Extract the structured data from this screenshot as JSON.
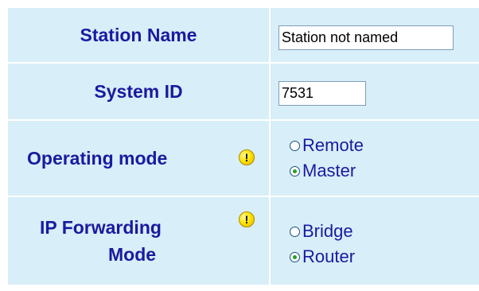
{
  "station_name": {
    "label": "Station Name",
    "value": "Station not named"
  },
  "system_id": {
    "label": "System ID",
    "value": "7531"
  },
  "operating_mode": {
    "label": "Operating mode",
    "warning_icon": "exclamation-warning-icon",
    "options": [
      {
        "label": "Remote",
        "checked": false
      },
      {
        "label": "Master",
        "checked": true
      }
    ]
  },
  "ip_forwarding": {
    "label_line1": "IP Forwarding",
    "label_line2": "Mode",
    "warning_icon": "exclamation-warning-icon",
    "options": [
      {
        "label": "Bridge",
        "checked": false
      },
      {
        "label": "Router",
        "checked": true
      }
    ]
  },
  "colors": {
    "panel_bg": "#d8eef8",
    "label_text": "#1a1aa0",
    "radio_dot": "#21a121",
    "warning": "#ffe600"
  }
}
